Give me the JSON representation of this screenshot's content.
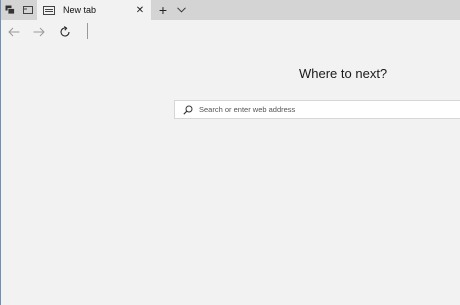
{
  "browser": {
    "tab": {
      "title": "New tab",
      "close_glyph": "✕"
    },
    "new_tab_glyph": "+",
    "icons": {
      "set_aside": "set-aside-tabs-icon",
      "tab_preview": "tab-preview-icon",
      "tab_page": "tab-page-icon",
      "close": "close-icon",
      "plus": "plus-icon",
      "tab_list": "chevron-down-icon",
      "back": "back-arrow-icon",
      "forward": "forward-arrow-icon",
      "refresh": "refresh-icon",
      "search": "search-icon"
    }
  },
  "page": {
    "headline": "Where to next?",
    "search": {
      "placeholder": "Search or enter web address",
      "value": ""
    }
  },
  "colors": {
    "tabstrip": "#d4d4d4",
    "background": "#f2f2f2",
    "search_bg": "#ffffff"
  }
}
